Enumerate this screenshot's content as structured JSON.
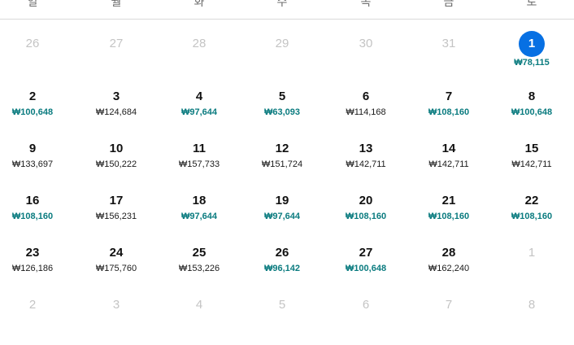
{
  "weekdays": [
    "일",
    "월",
    "화",
    "수",
    "목",
    "금",
    "토"
  ],
  "weeks": [
    [
      {
        "day": "26",
        "price": "",
        "muted": true
      },
      {
        "day": "27",
        "price": "",
        "muted": true
      },
      {
        "day": "28",
        "price": "",
        "muted": true
      },
      {
        "day": "29",
        "price": "",
        "muted": true
      },
      {
        "day": "30",
        "price": "",
        "muted": true
      },
      {
        "day": "31",
        "price": "",
        "muted": true
      },
      {
        "day": "1",
        "price": "₩78,115",
        "low": true,
        "selected": true
      }
    ],
    [
      {
        "day": "2",
        "price": "₩100,648",
        "low": true
      },
      {
        "day": "3",
        "price": "₩124,684"
      },
      {
        "day": "4",
        "price": "₩97,644",
        "low": true
      },
      {
        "day": "5",
        "price": "₩63,093",
        "low": true
      },
      {
        "day": "6",
        "price": "₩114,168"
      },
      {
        "day": "7",
        "price": "₩108,160",
        "low": true
      },
      {
        "day": "8",
        "price": "₩100,648",
        "low": true
      }
    ],
    [
      {
        "day": "9",
        "price": "₩133,697"
      },
      {
        "day": "10",
        "price": "₩150,222"
      },
      {
        "day": "11",
        "price": "₩157,733"
      },
      {
        "day": "12",
        "price": "₩151,724"
      },
      {
        "day": "13",
        "price": "₩142,711"
      },
      {
        "day": "14",
        "price": "₩142,711"
      },
      {
        "day": "15",
        "price": "₩142,711"
      }
    ],
    [
      {
        "day": "16",
        "price": "₩108,160",
        "low": true
      },
      {
        "day": "17",
        "price": "₩156,231"
      },
      {
        "day": "18",
        "price": "₩97,644",
        "low": true
      },
      {
        "day": "19",
        "price": "₩97,644",
        "low": true
      },
      {
        "day": "20",
        "price": "₩108,160",
        "low": true
      },
      {
        "day": "21",
        "price": "₩108,160",
        "low": true
      },
      {
        "day": "22",
        "price": "₩108,160",
        "low": true
      }
    ],
    [
      {
        "day": "23",
        "price": "₩126,186"
      },
      {
        "day": "24",
        "price": "₩175,760"
      },
      {
        "day": "25",
        "price": "₩153,226"
      },
      {
        "day": "26",
        "price": "₩96,142",
        "low": true
      },
      {
        "day": "27",
        "price": "₩100,648",
        "low": true
      },
      {
        "day": "28",
        "price": "₩162,240"
      },
      {
        "day": "1",
        "price": "",
        "muted": true
      }
    ],
    [
      {
        "day": "2",
        "price": "",
        "muted": true
      },
      {
        "day": "3",
        "price": "",
        "muted": true
      },
      {
        "day": "4",
        "price": "",
        "muted": true
      },
      {
        "day": "5",
        "price": "",
        "muted": true
      },
      {
        "day": "6",
        "price": "",
        "muted": true
      },
      {
        "day": "7",
        "price": "",
        "muted": true
      },
      {
        "day": "8",
        "price": "",
        "muted": true
      }
    ]
  ],
  "colors": {
    "selected": "#0770e3",
    "low_price": "#0a7b7f",
    "muted": "#c4c4c4"
  }
}
